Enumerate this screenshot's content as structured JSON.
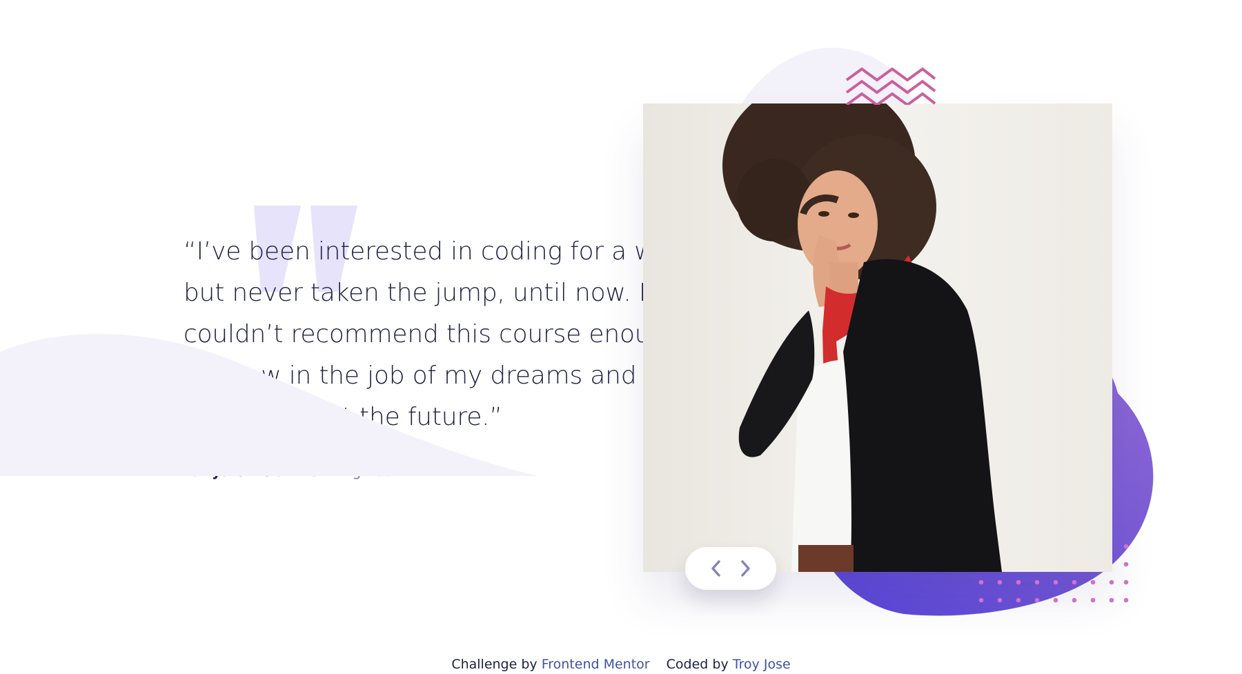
{
  "testimonial": {
    "quote": "“I’ve been interested in coding for a while\nbut never taken the jump, until now. I\ncouldn’t recommend this course enough.\nI’m now in the job of my dreams and so\nexcited about the future.”",
    "author_name": "Tanya Sinclair",
    "author_role": "UX Engineer"
  },
  "navigation": {
    "prev_icon": "chevron-left-icon",
    "next_icon": "chevron-right-icon"
  },
  "footer": {
    "challenge_prefix": "Challenge by",
    "challenge_link": "Frontend Mentor",
    "coded_prefix": "Coded by",
    "coded_link": "Troy Jose"
  },
  "colors": {
    "text_dark": "#202046",
    "text_muted": "#8585ac",
    "link": "#3e52a3",
    "curve_bg": "#f3f2fb",
    "quote_mark": "#e6e3fb",
    "zigzag": "#cc5f9b",
    "purple_light": "#8f69d4",
    "purple_dark": "#5745d8",
    "dots": "#d16fd1"
  }
}
